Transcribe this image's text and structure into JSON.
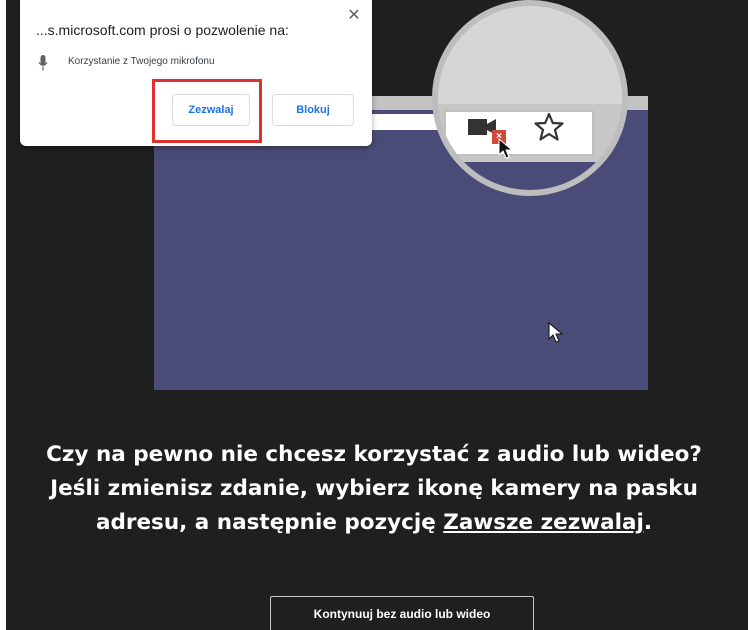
{
  "popup": {
    "title": "...s.microsoft.com prosi o pozwolenie na:",
    "close_glyph": "✕",
    "permission_icon": "microphone-icon",
    "permission_label": "Korzystanie z Twojego mikrofonu",
    "allow_label": "Zezwalaj",
    "block_label": "Blokuj"
  },
  "illustration": {
    "camera_icon": "camera-blocked-icon",
    "blocked_badge": "×",
    "bookmark_icon": "star-icon"
  },
  "message": {
    "line1": "Czy na pewno nie chcesz korzystać z audio lub wideo?",
    "line2": "Jeśli zmienisz zdanie, wybierz ikonę kamery na pasku",
    "line3_prefix": "adresu, a następnie pozycję ",
    "line3_link": "Zawsze zezwalaj",
    "line3_suffix": "."
  },
  "continue_label": "Kontynuuj bez audio lub wideo",
  "colors": {
    "background": "#1f1f1f",
    "frame": "#4b4b77",
    "accent": "#1a73e8",
    "highlight": "#e02f2f",
    "blocked": "#d04a3b"
  }
}
